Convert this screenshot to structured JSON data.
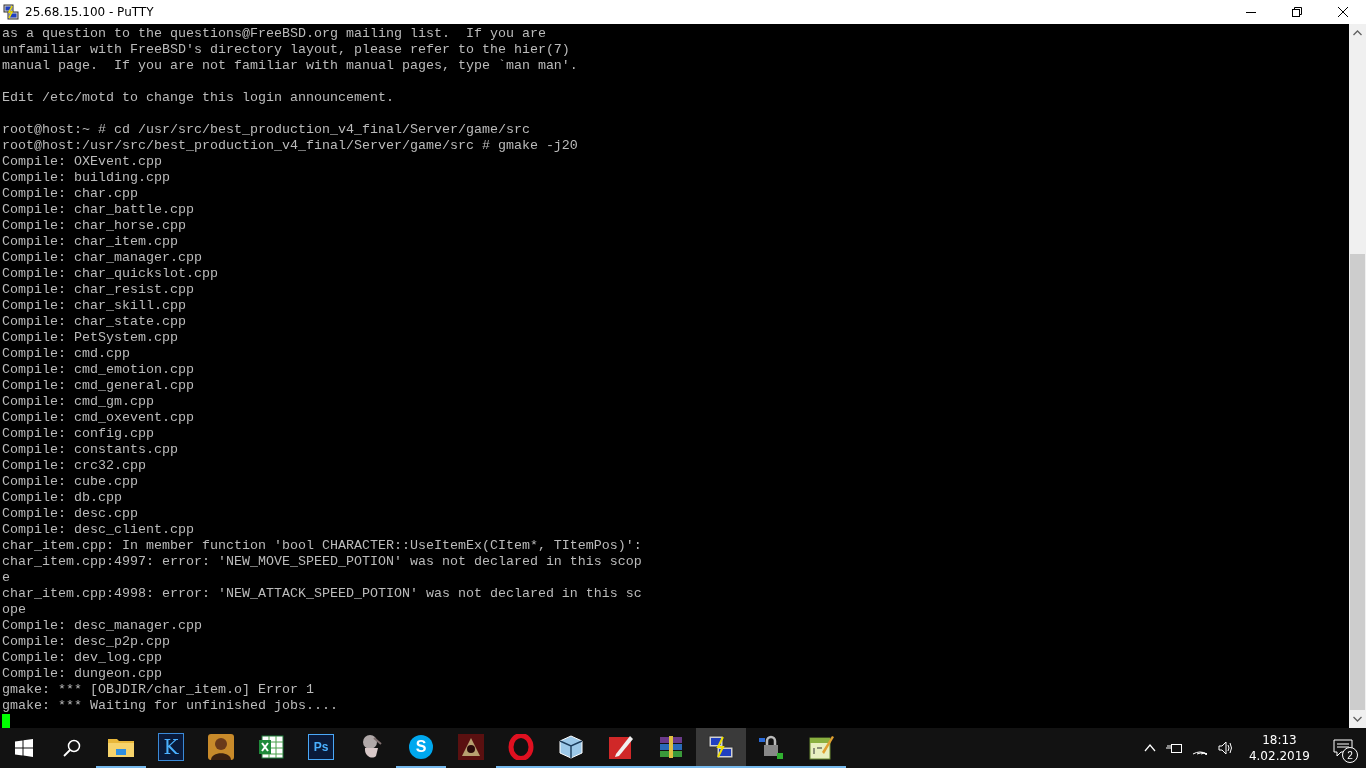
{
  "window": {
    "title": "25.68.15.100 - PuTTY"
  },
  "terminal": {
    "lines": [
      {
        "kind": "text",
        "text": "as a question to the questions@FreeBSD.org mailing list.  If you are"
      },
      {
        "kind": "text",
        "text": "unfamiliar with FreeBSD's directory layout, please refer to the hier(7)"
      },
      {
        "kind": "text",
        "text": "manual page.  If you are not familiar with manual pages, type `man man'."
      },
      {
        "kind": "blank"
      },
      {
        "kind": "text",
        "text": "Edit /etc/motd to change this login announcement."
      },
      {
        "kind": "blank"
      },
      {
        "kind": "text",
        "text": "root@host:~ # cd /usr/src/best_production_v4_final/Server/game/src"
      },
      {
        "kind": "text",
        "text": "root@host:/usr/src/best_production_v4_final/Server/game/src # gmake -j20"
      },
      {
        "kind": "text",
        "text": "Compile: OXEvent.cpp"
      },
      {
        "kind": "text",
        "text": "Compile: building.cpp"
      },
      {
        "kind": "text",
        "text": "Compile: char.cpp"
      },
      {
        "kind": "text",
        "text": "Compile: char_battle.cpp"
      },
      {
        "kind": "text",
        "text": "Compile: char_horse.cpp"
      },
      {
        "kind": "text",
        "text": "Compile: char_item.cpp"
      },
      {
        "kind": "text",
        "text": "Compile: char_manager.cpp"
      },
      {
        "kind": "text",
        "text": "Compile: char_quickslot.cpp"
      },
      {
        "kind": "text",
        "text": "Compile: char_resist.cpp"
      },
      {
        "kind": "text",
        "text": "Compile: char_skill.cpp"
      },
      {
        "kind": "text",
        "text": "Compile: char_state.cpp"
      },
      {
        "kind": "text",
        "text": "Compile: PetSystem.cpp"
      },
      {
        "kind": "text",
        "text": "Compile: cmd.cpp"
      },
      {
        "kind": "text",
        "text": "Compile: cmd_emotion.cpp"
      },
      {
        "kind": "text",
        "text": "Compile: cmd_general.cpp"
      },
      {
        "kind": "text",
        "text": "Compile: cmd_gm.cpp"
      },
      {
        "kind": "text",
        "text": "Compile: cmd_oxevent.cpp"
      },
      {
        "kind": "text",
        "text": "Compile: config.cpp"
      },
      {
        "kind": "text",
        "text": "Compile: constants.cpp"
      },
      {
        "kind": "text",
        "text": "Compile: crc32.cpp"
      },
      {
        "kind": "text",
        "text": "Compile: cube.cpp"
      },
      {
        "kind": "text",
        "text": "Compile: db.cpp"
      },
      {
        "kind": "text",
        "text": "Compile: desc.cpp"
      },
      {
        "kind": "text",
        "text": "Compile: desc_client.cpp"
      },
      {
        "kind": "text",
        "text": "char_item.cpp: In member function 'bool CHARACTER::UseItemEx(CItem*, TItemPos)':"
      },
      {
        "kind": "text",
        "text": "char_item.cpp:4997: error: 'NEW_MOVE_SPEED_POTION' was not declared in this scop"
      },
      {
        "kind": "text",
        "text": "e"
      },
      {
        "kind": "text",
        "text": "char_item.cpp:4998: error: 'NEW_ATTACK_SPEED_POTION' was not declared in this sc"
      },
      {
        "kind": "text",
        "text": "ope"
      },
      {
        "kind": "text",
        "text": "Compile: desc_manager.cpp"
      },
      {
        "kind": "text",
        "text": "Compile: desc_p2p.cpp"
      },
      {
        "kind": "text",
        "text": "Compile: dev_log.cpp"
      },
      {
        "kind": "text",
        "text": "Compile: dungeon.cpp"
      },
      {
        "kind": "text",
        "text": "gmake: *** [OBJDIR/char_item.o] Error 1"
      },
      {
        "kind": "text",
        "text": "gmake: *** Waiting for unfinished jobs...."
      },
      {
        "kind": "cursor"
      }
    ]
  },
  "taskbar": {
    "apps": [
      {
        "kind": "folder",
        "running": true,
        "selected": false
      },
      {
        "kind": "letter",
        "label": "K",
        "running": false,
        "selected": false
      },
      {
        "kind": "portrait",
        "running": false,
        "selected": false
      },
      {
        "kind": "sheet",
        "running": false,
        "selected": false
      },
      {
        "kind": "letter2",
        "label": "Ps",
        "running": false,
        "selected": false
      },
      {
        "kind": "figure",
        "running": false,
        "selected": false
      },
      {
        "kind": "bubble",
        "label": "S",
        "running": true,
        "selected": false
      },
      {
        "kind": "emblem",
        "running": false,
        "selected": false
      },
      {
        "kind": "ring",
        "running": true,
        "selected": false
      },
      {
        "kind": "cube",
        "running": true,
        "selected": false
      },
      {
        "kind": "pencil",
        "running": true,
        "selected": false
      },
      {
        "kind": "books",
        "running": true,
        "selected": false
      },
      {
        "kind": "terminal",
        "running": true,
        "selected": true
      },
      {
        "kind": "lock",
        "running": true,
        "selected": false
      },
      {
        "kind": "notepad",
        "running": true,
        "selected": false
      }
    ],
    "clock": {
      "time": "18:13",
      "date": "4.02.2019"
    },
    "notifications": {
      "count": "2"
    }
  }
}
